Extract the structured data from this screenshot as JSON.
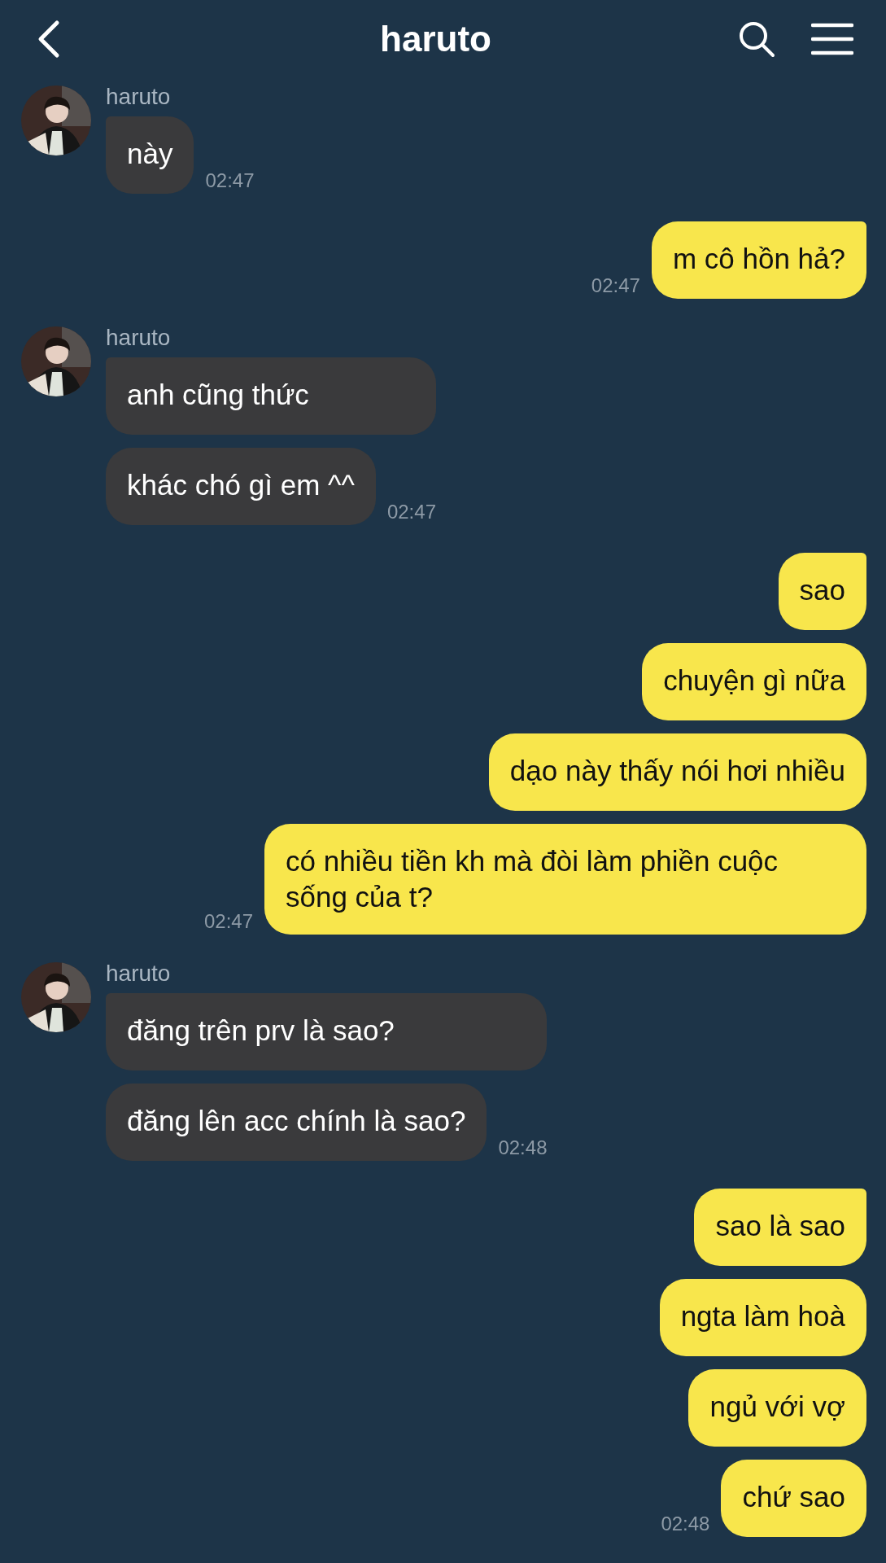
{
  "header": {
    "title": "haruto"
  },
  "groups": [
    {
      "kind": "received",
      "sender": "haruto",
      "messages": [
        "này"
      ],
      "time": "02:47"
    },
    {
      "kind": "sent",
      "messages": [
        "m cô hồn hả?"
      ],
      "time": "02:47"
    },
    {
      "kind": "received",
      "sender": "haruto",
      "messages": [
        "anh cũng thức",
        "khác chó gì em ^^"
      ],
      "time": "02:47"
    },
    {
      "kind": "sent",
      "messages": [
        "sao",
        "chuyện gì nữa",
        "dạo này thấy nói hơi nhiều",
        "có nhiều tiền kh mà đòi làm phiền cuộc sống của t?"
      ],
      "time": "02:47"
    },
    {
      "kind": "received",
      "sender": "haruto",
      "messages": [
        "đăng trên prv là sao?",
        "đăng lên acc chính là sao?"
      ],
      "time": "02:48"
    },
    {
      "kind": "sent",
      "messages": [
        "sao là sao",
        "ngta làm hoà",
        "ngủ với vợ",
        "chứ sao"
      ],
      "time": "02:48"
    }
  ]
}
